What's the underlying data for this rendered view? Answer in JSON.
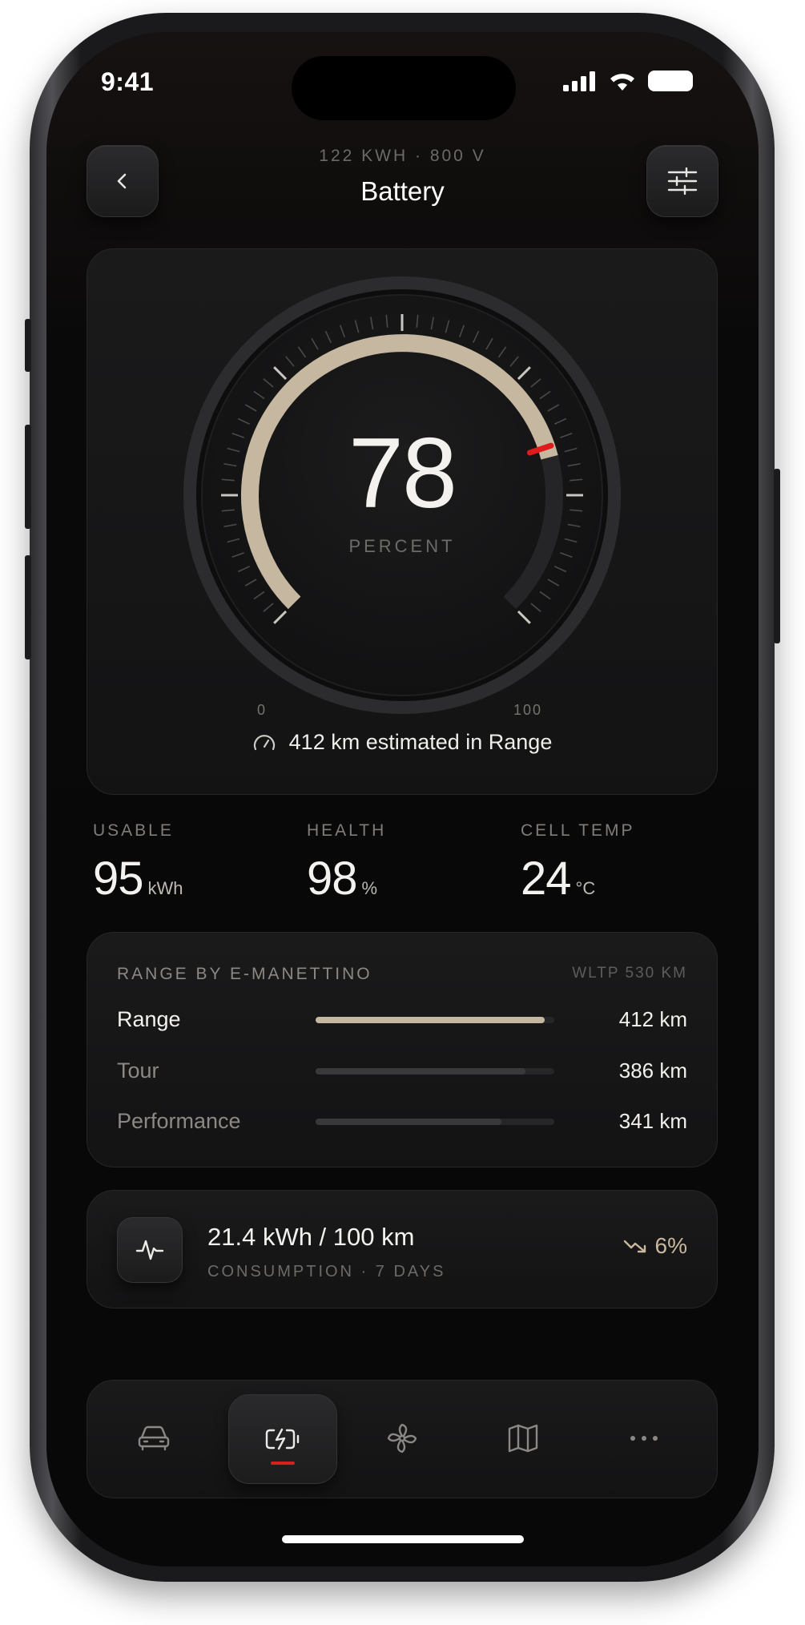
{
  "status_bar": {
    "time": "9:41"
  },
  "header": {
    "subtitle": "122 KWH · 800 V",
    "title": "Battery",
    "back_icon": "chevron-left-icon",
    "settings_icon": "sliders-icon"
  },
  "gauge": {
    "value": "78",
    "percent": 78,
    "unit": "PERCENT",
    "scale_min": "0",
    "scale_max": "100",
    "range_text": "412 km estimated in Range",
    "accent_color": "#c6b8a0",
    "marker_color": "#e01b1b"
  },
  "stats": [
    {
      "label": "USABLE",
      "value": "95",
      "unit": "kWh"
    },
    {
      "label": "HEALTH",
      "value": "98",
      "unit": "%"
    },
    {
      "label": "CELL TEMP",
      "value": "24",
      "unit": "°C"
    }
  ],
  "modes": {
    "title": "RANGE BY E-MANETTINO",
    "reference": "WLTP 530 KM",
    "items": [
      {
        "name": "Range",
        "value": "412 km",
        "fraction": 0.96,
        "active": true
      },
      {
        "name": "Tour",
        "value": "386 km",
        "fraction": 0.88,
        "active": false
      },
      {
        "name": "Performance",
        "value": "341 km",
        "fraction": 0.78,
        "active": false
      }
    ]
  },
  "consumption": {
    "value": "21.4 kWh / 100 km",
    "label": "CONSUMPTION · 7 DAYS",
    "trend": "6%",
    "trend_icon": "trending-down-icon",
    "icon": "activity-icon"
  },
  "nav": {
    "items": [
      {
        "icon": "car-icon",
        "active": false
      },
      {
        "icon": "battery-charging-icon",
        "active": true
      },
      {
        "icon": "fan-icon",
        "active": false
      },
      {
        "icon": "map-icon",
        "active": false
      },
      {
        "icon": "more-icon",
        "active": false
      }
    ]
  }
}
